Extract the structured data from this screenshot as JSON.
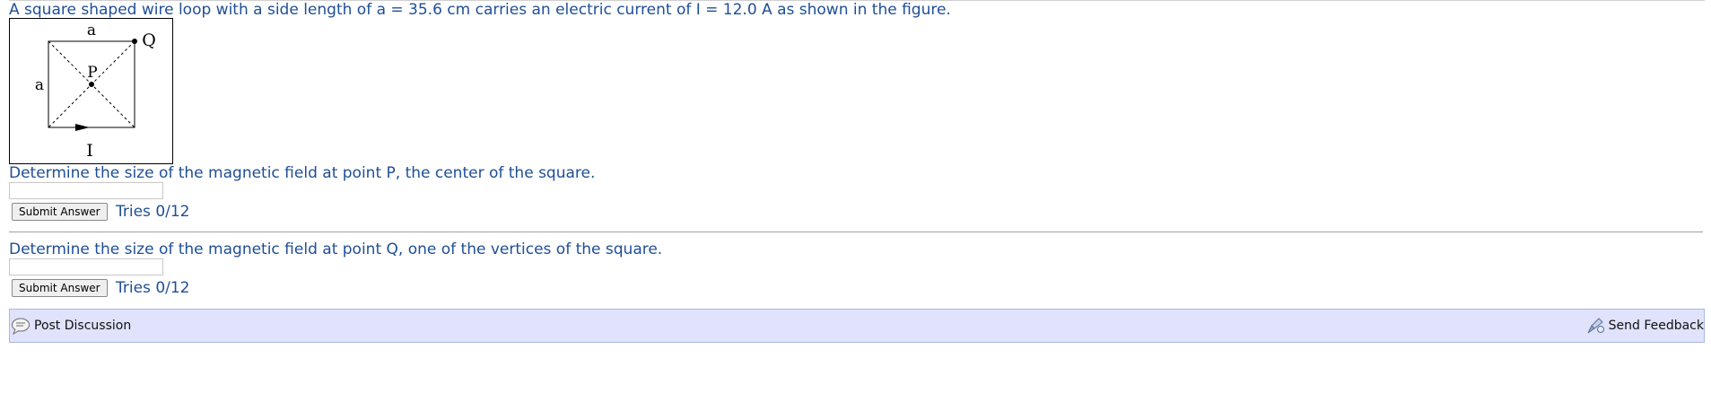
{
  "problem": {
    "statement": "A square shaped wire loop with a side length of a = 35.6 cm carries an electric current of I = 12.0 A as shown in the figure."
  },
  "figure": {
    "label_top": "a",
    "label_left": "a",
    "label_bottom": "I",
    "label_center": "P",
    "label_corner": "Q"
  },
  "parts": [
    {
      "question": "Determine the size of the magnetic field at point P, the center of the square.",
      "answer_value": "",
      "submit_label": "Submit Answer",
      "tries": "Tries 0/12"
    },
    {
      "question": "Determine the size of the magnetic field at point Q, one of the vertices of the square.",
      "answer_value": "",
      "submit_label": "Submit Answer",
      "tries": "Tries 0/12"
    }
  ],
  "footer": {
    "post_discussion": "Post Discussion",
    "send_feedback": "Send Feedback",
    "bar_background": "#e0e3fb",
    "text_color": "#1f4e96",
    "icons": [
      "discussion-icon",
      "feedback-icon"
    ]
  }
}
